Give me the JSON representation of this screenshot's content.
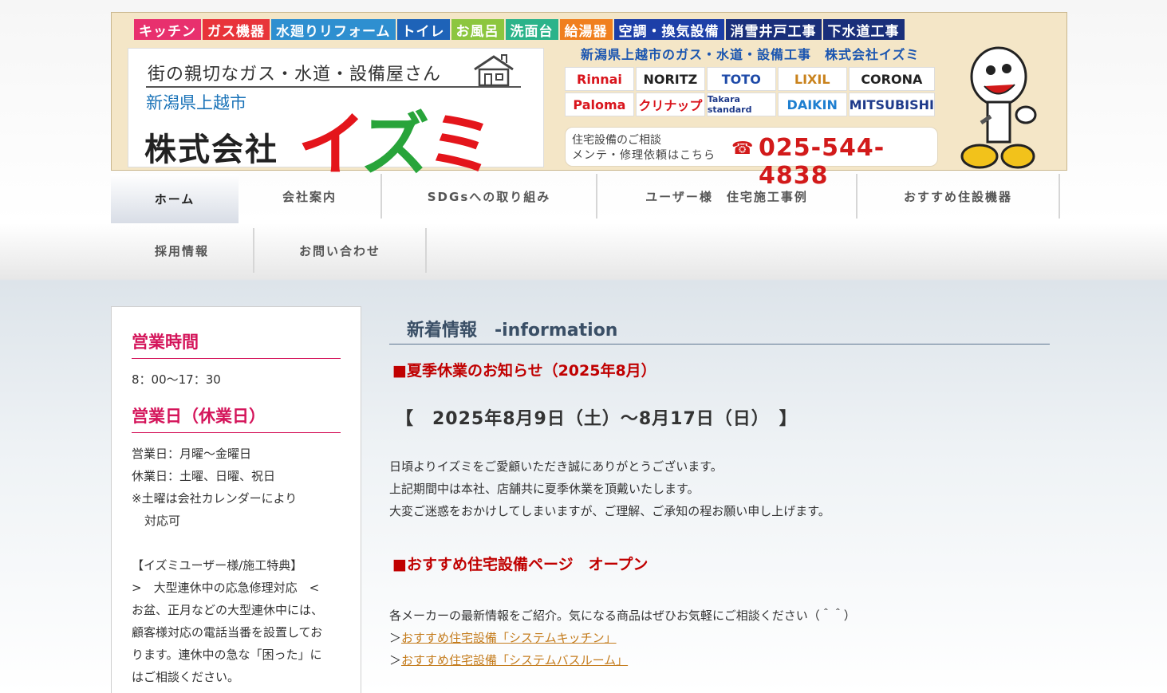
{
  "banner": {
    "categories": [
      {
        "label": "キッチン",
        "color": "#e8306e"
      },
      {
        "label": "ガス機器",
        "color": "#e8343a"
      },
      {
        "label": "水廻りリフォーム",
        "color": "#2e8fd0"
      },
      {
        "label": "トイレ",
        "color": "#1e63b8"
      },
      {
        "label": "お風呂",
        "color": "#8cc63f"
      },
      {
        "label": "洗面台",
        "color": "#2bb38a"
      },
      {
        "label": "給湯器",
        "color": "#f07f1e"
      },
      {
        "label": "空調・換気設備",
        "color": "#1d3fa8"
      },
      {
        "label": "消雪井戸工事",
        "color": "#1a2f7a"
      },
      {
        "label": "下水道工事",
        "color": "#1a2f7a"
      }
    ],
    "tagline": "街の親切なガス・水道・設備屋さん",
    "region": "新潟県上越市",
    "corp": "株式会社",
    "logo": [
      "イ",
      "ズ",
      "ミ"
    ],
    "subtitle": "新潟県上越市のガス・水道・設備工事　株式会社イズミ",
    "brands": [
      {
        "label": "Rinnai",
        "color": "#d9141c"
      },
      {
        "label": "NORITZ",
        "color": "#222222"
      },
      {
        "label": "TOTO",
        "color": "#1e4aa8"
      },
      {
        "label": "LIXIL",
        "color": "#c9821c"
      },
      {
        "label": "CORONA",
        "color": "#222222"
      },
      {
        "label": "Paloma",
        "color": "#d9141c"
      },
      {
        "label": "クリナップ",
        "color": "#d9141c"
      },
      {
        "label": "Takara standard",
        "color": "#1e3a8a"
      },
      {
        "label": "DAIKIN",
        "color": "#1e7fd0"
      },
      {
        "label": "MITSUBISHI",
        "color": "#1e3a8a"
      }
    ],
    "contact_line1": "住宅設備のご相談",
    "contact_line2": "メンテ・修理依頼はこちら",
    "phone": "025-544-4838"
  },
  "nav": {
    "row1": [
      {
        "label": "ホーム",
        "width": 160,
        "active": true
      },
      {
        "label": "会社案内",
        "width": 180
      },
      {
        "label": "SDGsへの取り組み",
        "width": 270
      },
      {
        "label": "ユーザー様　住宅施工事例",
        "width": 326
      },
      {
        "label": "おすすめ住設機器",
        "width": 254
      }
    ],
    "row2": [
      {
        "label": "採用情報",
        "width": 180
      },
      {
        "label": "お問い合わせ",
        "width": 216
      }
    ]
  },
  "sidebar": {
    "hours_heading": "営業時間",
    "hours": "8：00〜17：30",
    "days_heading": "営業日（休業日）",
    "open_days": "営業日：月曜〜金曜日",
    "closed_days": "休業日：土曜、日曜、祝日",
    "note1": "※土曜は会社カレンダーにより",
    "note2": "対応可",
    "perk_title": "【イズミユーザー様/施工特典】",
    "perk_sub": ">　大型連休中の応急修理対応　<",
    "perk_l1": "お盆、正月などの大型連休中には、",
    "perk_l2": "顧客様対応の電話当番を設置してお",
    "perk_l3": "ります。連休中の急な「困った」に",
    "perk_l4": "はご相談ください。"
  },
  "main": {
    "heading": "新着情報　-information",
    "news1_title": "■夏季休業のお知らせ（2025年8月）",
    "news1_date": "【　2025年8月9日（土）〜8月17日（日）　】",
    "news1_l1": "日頃よりイズミをご愛顧いただき誠にありがとうございます。",
    "news1_l2": "上記期間中は本社、店舗共に夏季休業を頂戴いたします。",
    "news1_l3": "大変ご迷惑をおかけしてしまいますが、ご理解、ご承知の程お願い申し上げます。",
    "news2_title": "■おすすめ住宅設備ページ　オープン",
    "news2_l1": "各メーカーの最新情報をご紹介。気になる商品はぜひお気軽にご相談ください（＾＾）",
    "link_prefix": "＞",
    "link1": "おすすめ住宅設備「システムキッチン」",
    "link2": "おすすめ住宅設備「システムバスルーム」"
  }
}
